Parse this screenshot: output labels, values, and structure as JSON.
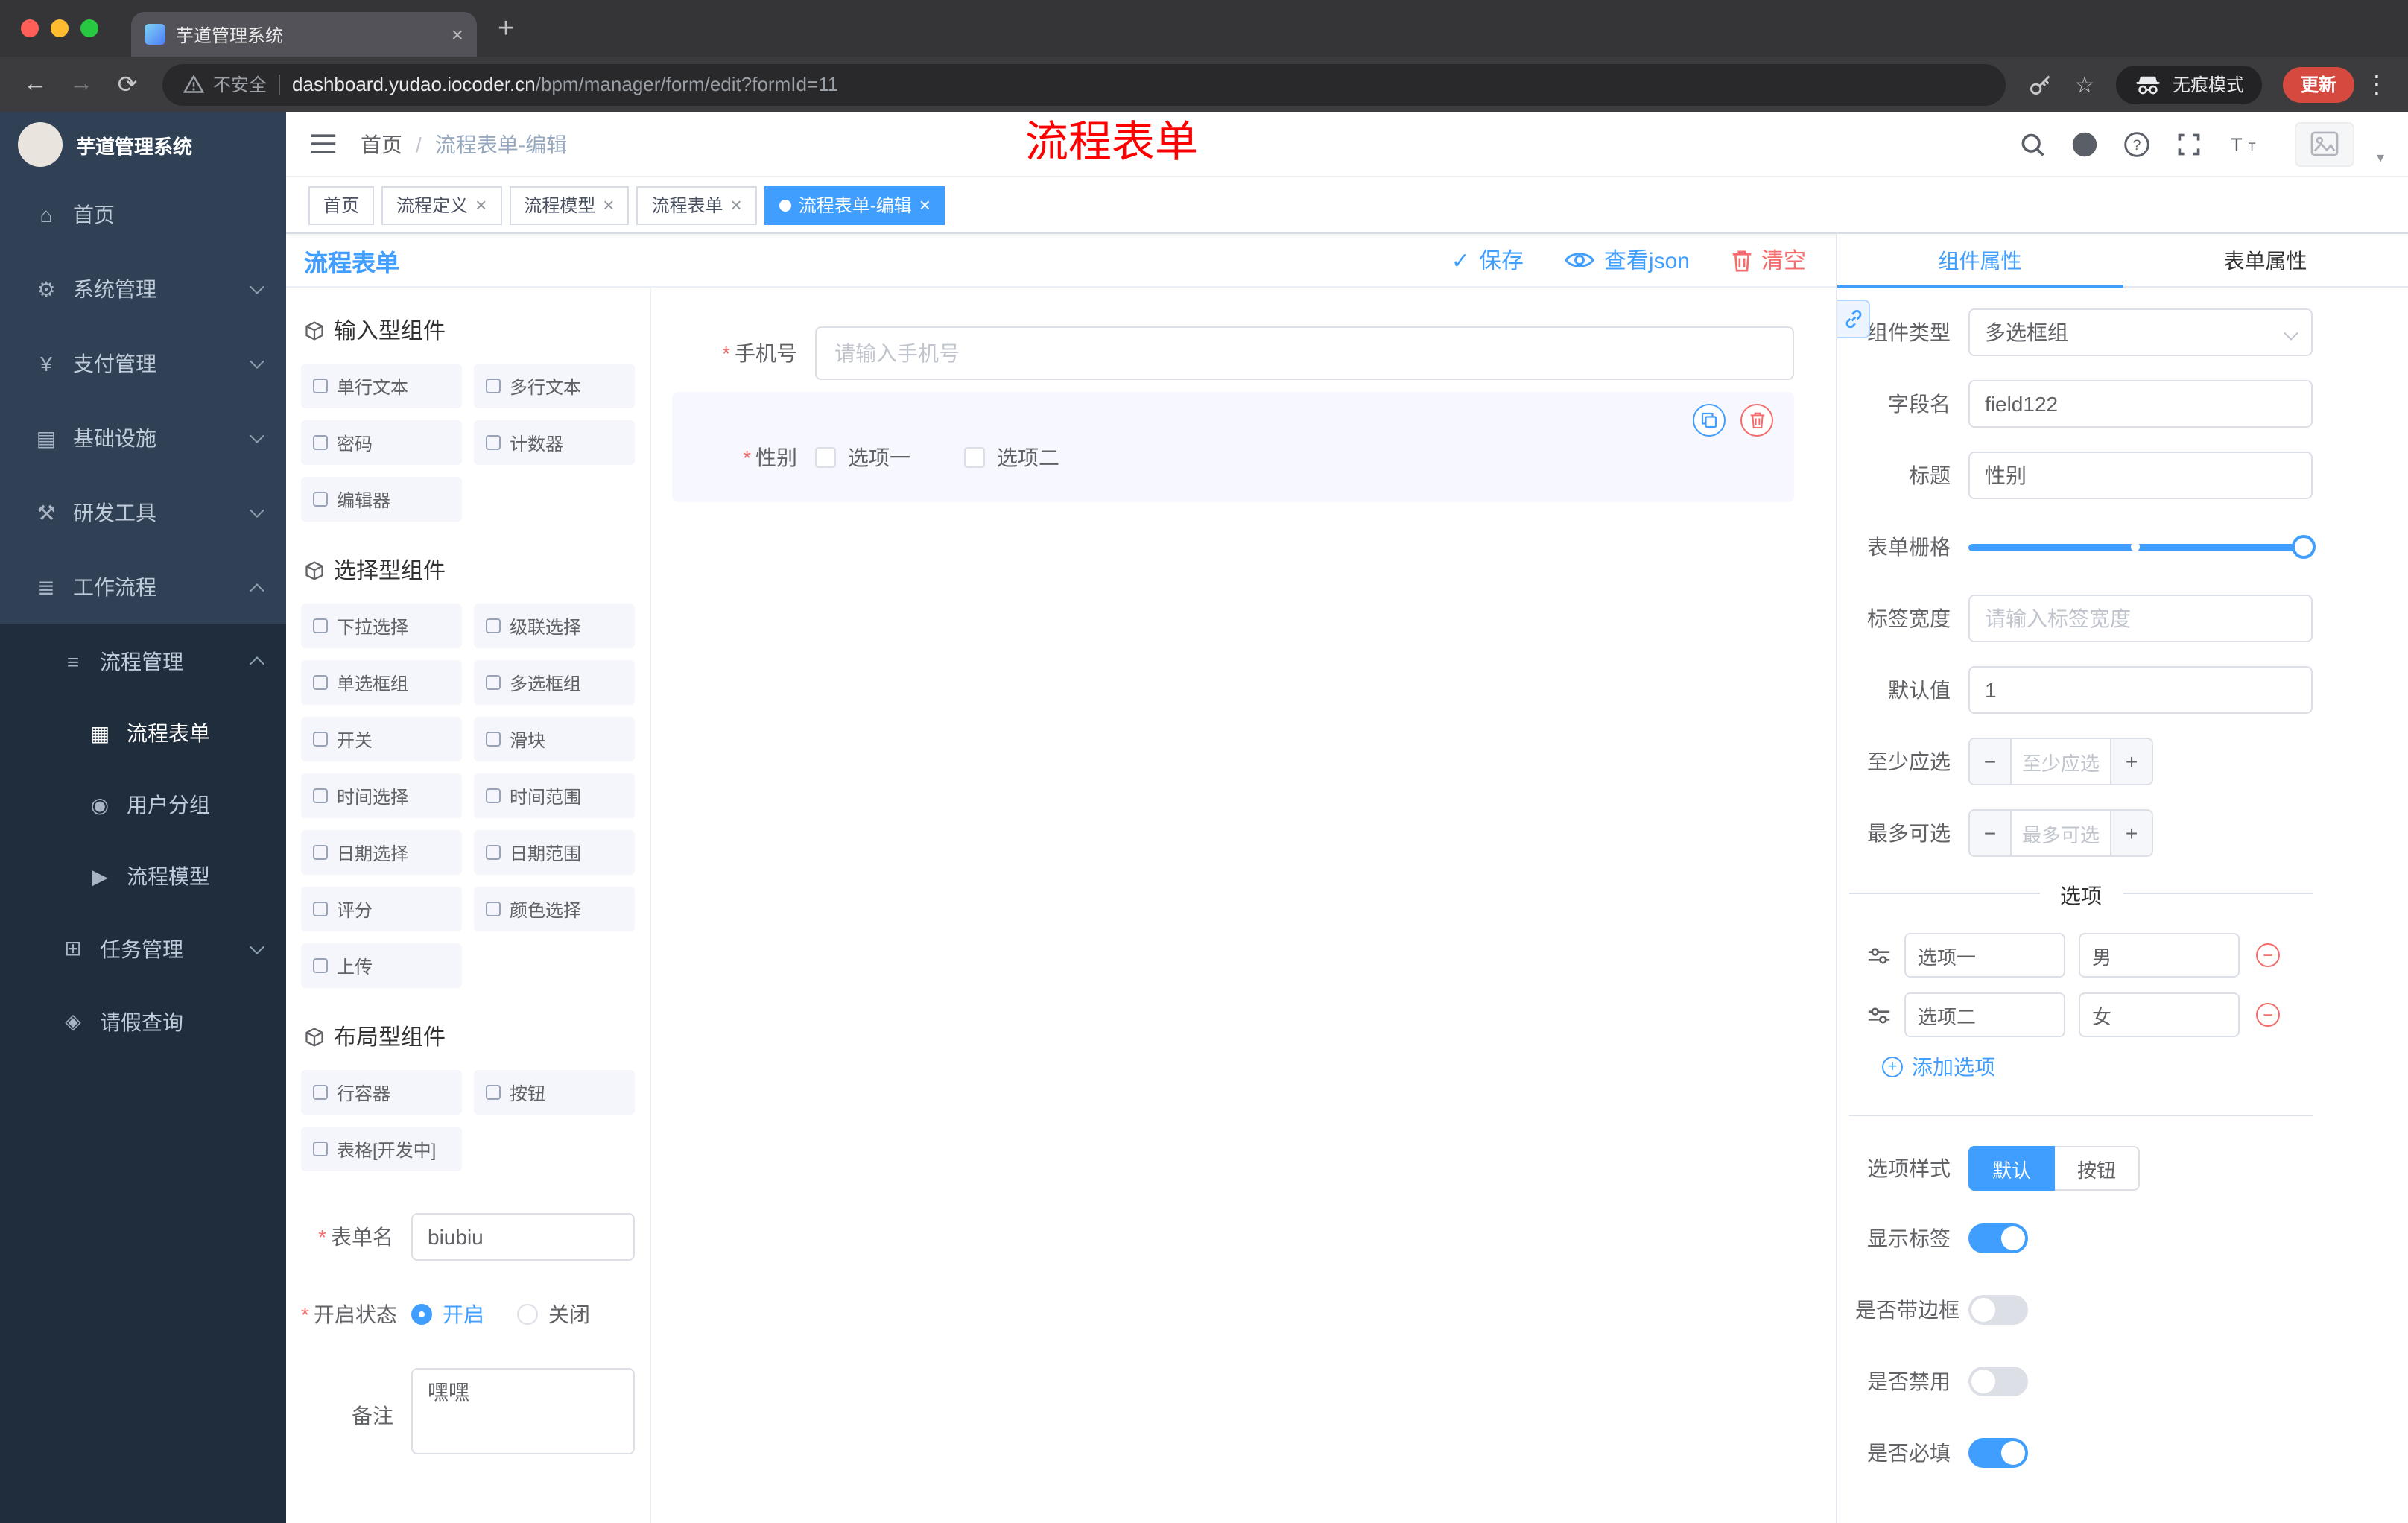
{
  "browser": {
    "tab_title": "芋道管理系统",
    "security_label": "不安全",
    "url_host": "dashboard.yudao.iocoder.cn",
    "url_path": "/bpm/manager/form/edit?formId=11",
    "incognito_label": "无痕模式",
    "update_label": "更新"
  },
  "ui": {
    "close": "×",
    "plus": "+",
    "minus": "−",
    "check": "✓",
    "back": "←",
    "forward": "→",
    "reload": "⟳",
    "menu_dots": "⋮",
    "caret_down": "▾",
    "star": "☆",
    "breadcrumb_sep": "/",
    "required_mark": "*",
    "question": "?"
  },
  "icons": {
    "home": "⌂",
    "system": "⚙",
    "payment": "¥",
    "infra": "▤",
    "devtools": "⚒",
    "workflow": "≣",
    "process_mgmt": "≡",
    "process_form": "▦",
    "user_group": "◉",
    "process_model": "▶",
    "task_mgmt": "⊞",
    "leave_query": "◈"
  },
  "sidebar": {
    "logo_title": "芋道管理系统",
    "home": "首页",
    "system": "系统管理",
    "payment": "支付管理",
    "infra": "基础设施",
    "devtools": "研发工具",
    "workflow": "工作流程",
    "process_mgmt": "流程管理",
    "process_form": "流程表单",
    "user_group": "用户分组",
    "process_model": "流程模型",
    "task_mgmt": "任务管理",
    "leave_query": "请假查询"
  },
  "header": {
    "breadcrumb_home": "首页",
    "breadcrumb_current": "流程表单-编辑",
    "annotation": "流程表单"
  },
  "tags": [
    {
      "label": "首页"
    },
    {
      "label": "流程定义"
    },
    {
      "label": "流程模型"
    },
    {
      "label": "流程表单"
    },
    {
      "label": "流程表单-编辑"
    }
  ],
  "toolbar": {
    "title": "流程表单",
    "save": "保存",
    "view_json": "查看json",
    "clear": "清空"
  },
  "components": {
    "input_group": "输入型组件",
    "input_items": [
      "单行文本",
      "多行文本",
      "密码",
      "计数器",
      "编辑器"
    ],
    "select_group": "选择型组件",
    "select_items": [
      "下拉选择",
      "级联选择",
      "单选框组",
      "多选框组",
      "开关",
      "滑块",
      "时间选择",
      "时间范围",
      "日期选择",
      "日期范围",
      "评分",
      "颜色选择",
      "上传"
    ],
    "layout_group": "布局型组件",
    "layout_items": [
      "行容器",
      "按钮",
      "表格[开发中]"
    ]
  },
  "form_meta": {
    "name_label": "表单名",
    "name_value": "biubiu",
    "status_label": "开启状态",
    "status_on": "开启",
    "status_off": "关闭",
    "remark_label": "备注",
    "remark_value": "嘿嘿"
  },
  "canvas": {
    "phone_label": "手机号",
    "phone_placeholder": "请输入手机号",
    "gender_label": "性别",
    "gender_options": [
      "选项一",
      "选项二"
    ]
  },
  "props": {
    "tab_component": "组件属性",
    "tab_form": "表单属性",
    "type_label": "组件类型",
    "type_value": "多选框组",
    "field_label": "字段名",
    "field_value": "field122",
    "title_label": "标题",
    "title_value": "性别",
    "grid_label": "表单栅格",
    "label_width_label": "标签宽度",
    "label_width_placeholder": "请输入标签宽度",
    "default_label": "默认值",
    "default_value": "1",
    "min_label": "至少应选",
    "min_placeholder": "至少应选",
    "max_label": "最多可选",
    "max_placeholder": "最多可选",
    "options_title": "选项",
    "options": [
      {
        "label": "选项一",
        "value": "男"
      },
      {
        "label": "选项二",
        "value": "女"
      }
    ],
    "add_option": "添加选项",
    "style_label": "选项样式",
    "style_default": "默认",
    "style_button": "按钮",
    "show_label": "显示标签",
    "border_label": "是否带边框",
    "disabled_label": "是否禁用",
    "required_label": "是否必填"
  },
  "colors": {
    "accent": "#409EFF",
    "danger": "#F56C6C",
    "sidebar_bg": "#304156",
    "submenu_bg": "#1F2D3D",
    "annotation": "#FF0000"
  }
}
